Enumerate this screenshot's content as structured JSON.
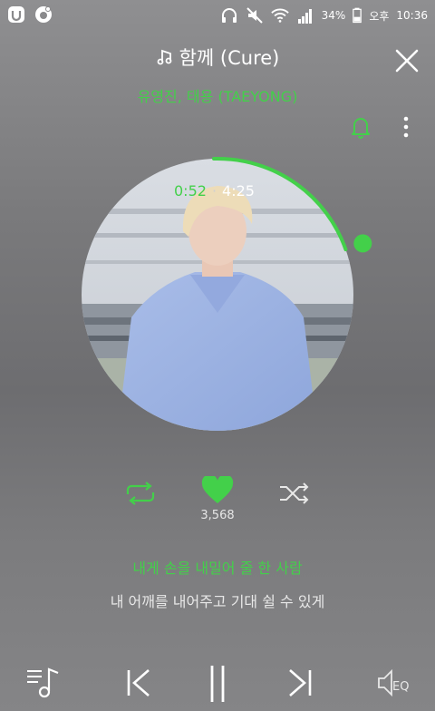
{
  "status_bar": {
    "battery": "34%",
    "ampm": "오후",
    "time": "10:36",
    "icons": [
      "app-badge-icon",
      "music-app-icon",
      "headphones-icon",
      "mute-icon",
      "wifi-icon",
      "signal-icon",
      "battery-icon"
    ]
  },
  "header": {
    "title": "함께 (Cure)",
    "artist": "유영진, 태용 (TAEYONG)"
  },
  "playback": {
    "current_time": "0:52",
    "separator": "·",
    "total_time": "4:25",
    "progress": 0.196
  },
  "likes": {
    "count": "3,568"
  },
  "lyrics": {
    "current": "내게 손을 내밀어 줄 한 사람",
    "next": "내 어깨를 내어주고 기대 쉴 수 있게"
  },
  "bottom": {
    "eq_label": "EQ"
  },
  "colors": {
    "accent": "#43d04a",
    "text": "#ffffff"
  }
}
